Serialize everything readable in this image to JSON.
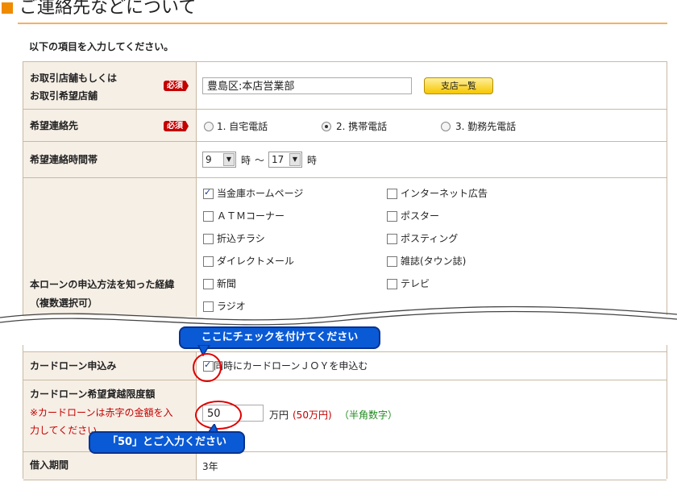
{
  "header": {
    "title": "ご連絡先などについて"
  },
  "intro": "以下の項目を入力してください。",
  "required_label": "必須",
  "branch": {
    "label1": "お取引店舗もしくは",
    "label2": "お取引希望店舗",
    "value": "豊島区:本店営業部",
    "button": "支店一覧"
  },
  "contact": {
    "label": "希望連絡先",
    "options": [
      "1. 自宅電話",
      "2. 携帯電話",
      "3. 勤務先電話"
    ],
    "selected_index": 1
  },
  "time": {
    "label": "希望連絡時間帯",
    "from": "9",
    "to": "17",
    "unit": "時",
    "sep": "～"
  },
  "source": {
    "label1": "本ローンの申込方法を知った経緯",
    "label2": "（複数選択可）",
    "left": [
      {
        "label": "当金庫ホームページ",
        "checked": true
      },
      {
        "label": "ＡＴＭコーナー",
        "checked": false
      },
      {
        "label": "折込チラシ",
        "checked": false
      },
      {
        "label": "ダイレクトメール",
        "checked": false
      },
      {
        "label": "新聞",
        "checked": false
      },
      {
        "label": "ラジオ",
        "checked": false
      }
    ],
    "right": [
      {
        "label": "インターネット広告",
        "checked": false
      },
      {
        "label": "ポスター",
        "checked": false
      },
      {
        "label": "ポスティング",
        "checked": false
      },
      {
        "label": "雑誌(タウン誌)",
        "checked": false
      },
      {
        "label": "テレビ",
        "checked": false
      }
    ]
  },
  "callout1": "ここにチェックを付けてください",
  "card": {
    "label": "カードローン申込み",
    "checkbox_label": "同時にカードローンＪＯＹを申込む",
    "checked": true
  },
  "limit": {
    "label": "カードローン希望貸越限度額",
    "note1": "※カードローンは赤字の金額を入",
    "note2": "力してください",
    "value": "50",
    "unit": "万円",
    "red_hint": "(50万円)",
    "green_hint": "（半角数字）"
  },
  "callout2": "「50」とご入力ください",
  "period": {
    "label": "借入期間",
    "value": "3年"
  },
  "colors": {
    "accent": "#f08a00",
    "required": "#c40000",
    "callout": "#0a5ad6",
    "label_bg": "#f6efe6"
  }
}
